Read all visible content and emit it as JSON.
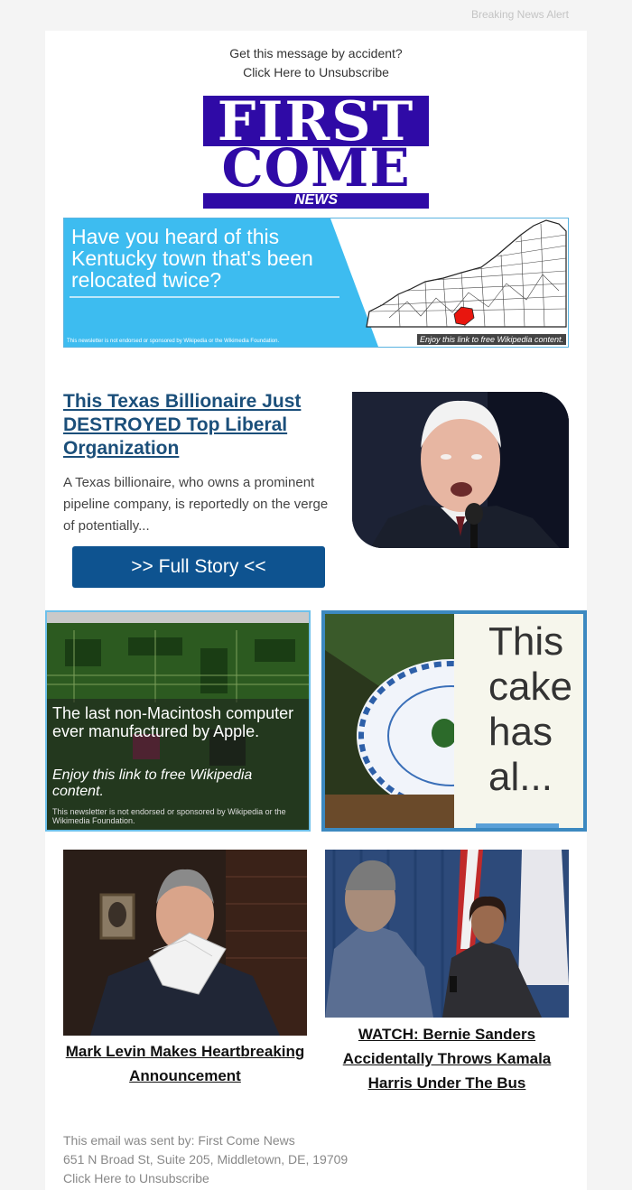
{
  "preheader": {
    "text": "Breaking News Alert"
  },
  "top": {
    "line1": "Get this message by accident?",
    "line2": "Click Here to Unsubscribe"
  },
  "logo": {
    "line1": "FIRST",
    "line2": "COME",
    "line3": "NEWS"
  },
  "banner": {
    "headline": "Have you heard of this Kentucky town that's been relocated twice?",
    "disclaimer": "This newsletter is not endorsed or sponsored by Wikipedia or the Wikimedia Foundation.",
    "enjoy": "Enjoy this link to free Wikipedia content."
  },
  "story": {
    "title": "This Texas Billionaire Just DESTROYED Top Liberal Organization",
    "excerpt": "A Texas billionaire, who owns a prominent pipeline company, is reportedly on the verge of potentially...",
    "button": ">> Full Story <<"
  },
  "ad_left": {
    "line1": "The last non-Macintosh computer ever manufactured by Apple.",
    "line2": "Enjoy this link to free Wikipedia content.",
    "line3": "This newsletter is not endorsed or sponsored by Wikipedia or the Wikimedia Foundation."
  },
  "ad_right": {
    "text_lines": [
      "This",
      "cake",
      "has",
      "al..."
    ]
  },
  "thumbs": [
    {
      "title": "Mark Levin Makes Heartbreaking Announcement"
    },
    {
      "title": "WATCH: Bernie Sanders Accidentally Throws Kamala Harris Under The Bus"
    }
  ],
  "footer": {
    "sent_by": "This email was sent by: First Come News",
    "address": "651 N Broad St, Suite 205, Middletown, DE, 19709",
    "unsubscribe": "Click Here to Unsubscribe"
  },
  "colors": {
    "brand": "#2f0aa6",
    "button": "#0e5390",
    "link": "#1b4f7a",
    "banner_blue": "#3dbcf0"
  },
  "icons": [
    "kentucky-map",
    "circuit-board",
    "cake-plate"
  ]
}
